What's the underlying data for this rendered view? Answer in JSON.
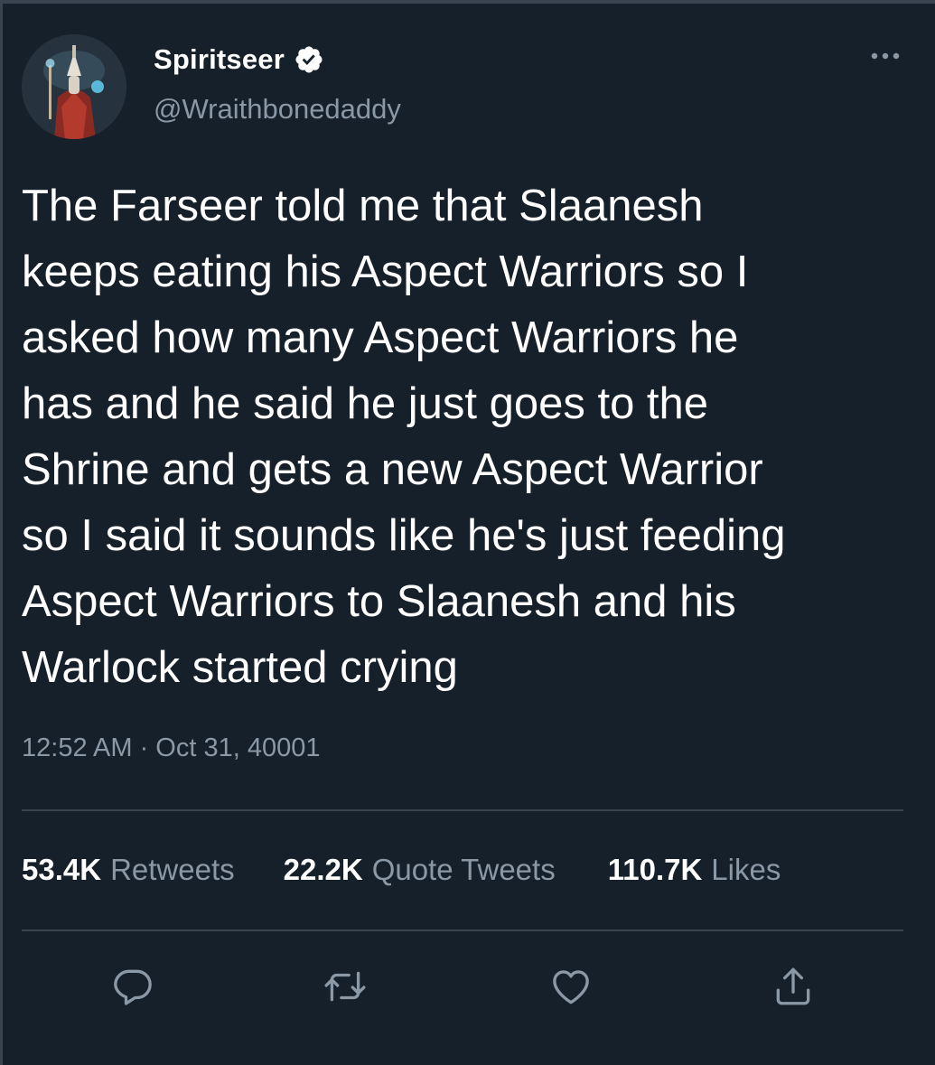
{
  "tweet": {
    "author_name": "Spiritseer",
    "author_handle": "@Wraithbonedaddy",
    "text_lines": [
      "The Farseer told me that Slaanesh",
      "keeps eating his Aspect Warriors so I",
      "asked how many Aspect Warriors he",
      "has and he said he just goes to the",
      "Shrine and gets a new Aspect Warrior",
      "so I said it sounds like he's just feeding",
      "Aspect Warriors to Slaanesh and his",
      "Warlock started crying"
    ],
    "timestamp": "12:52 AM · Oct 31, 40001",
    "stats": [
      {
        "count": "53.4K",
        "label": "Retweets"
      },
      {
        "count": "22.2K",
        "label": "Quote Tweets"
      },
      {
        "count": "110.7K",
        "label": "Likes"
      }
    ]
  },
  "icons": {
    "verified": "verified-badge-icon",
    "more": "more-options-icon",
    "reply": "reply-icon",
    "retweet": "retweet-icon",
    "like": "heart-icon",
    "share": "share-icon"
  },
  "colors": {
    "background": "#15202b",
    "primary_text": "#ffffff",
    "secondary_text": "#8b98a5",
    "divider": "#38444d",
    "verified": "#ffffff"
  }
}
